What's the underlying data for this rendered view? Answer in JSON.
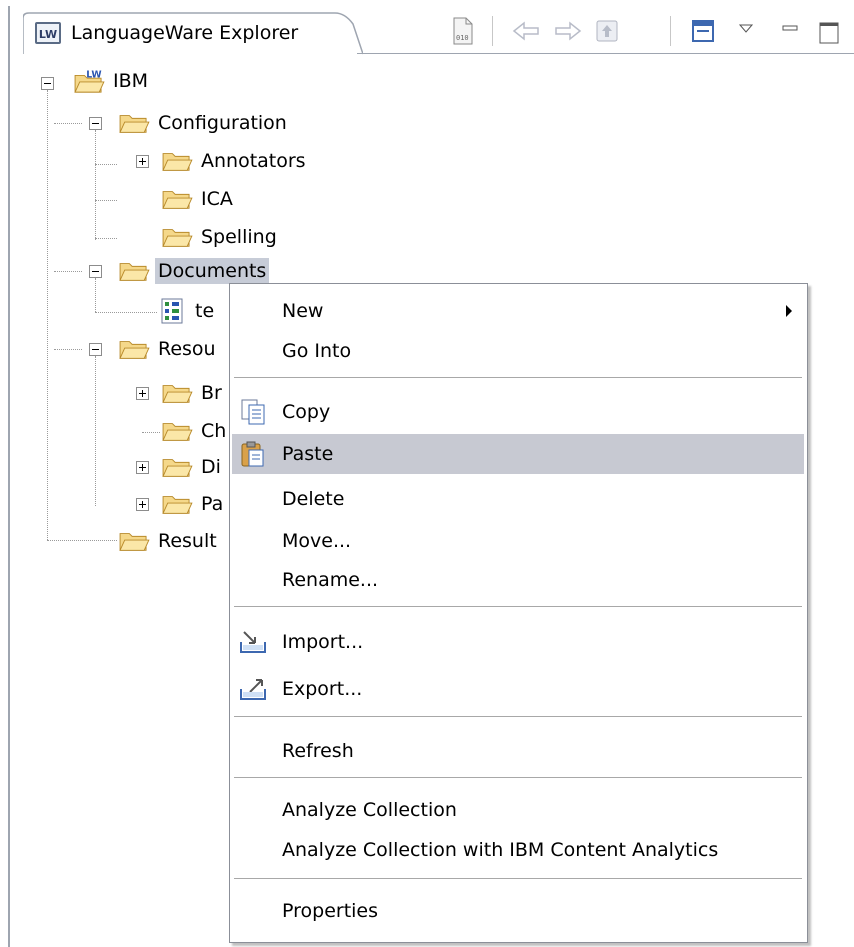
{
  "view": {
    "tab_badge": "LW",
    "tab_title": "LanguageWare Explorer"
  },
  "tree": {
    "root": "IBM",
    "configuration": "Configuration",
    "annotators": "Annotators",
    "ica": "ICA",
    "spelling": "Spelling",
    "documents": "Documents",
    "documents_child": "te",
    "resources": "Resou",
    "res_child_1": "Br",
    "res_child_2": "Ch",
    "res_child_3": "Di",
    "res_child_4": "Pa",
    "results": "Result"
  },
  "menu": {
    "new": "New",
    "go_into": "Go Into",
    "copy": "Copy",
    "paste": "Paste",
    "delete": "Delete",
    "move": "Move...",
    "rename": "Rename...",
    "import": "Import...",
    "export": "Export...",
    "refresh": "Refresh",
    "analyze": "Analyze Collection",
    "analyze_ica": "Analyze Collection with IBM Content Analytics",
    "properties": "Properties"
  },
  "colors": {
    "folder_fill": "#f5d88a",
    "folder_stroke": "#b88a2a",
    "selection": "#c7ccd7",
    "menu_highlight": "#c7c9d2"
  }
}
